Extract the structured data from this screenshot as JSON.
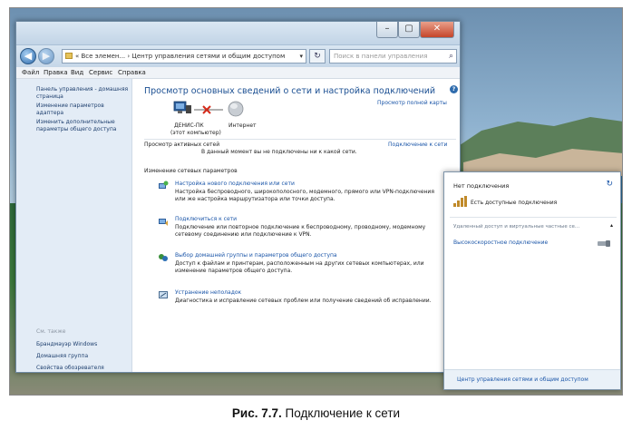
{
  "window": {
    "address": "« Все элемен... › Центр управления сетями и общим доступом",
    "search_placeholder": "Поиск в панели управления",
    "close_glyph": "✕",
    "max_glyph": "▢",
    "min_glyph": "–",
    "back_glyph": "◀",
    "forward_glyph": "▶",
    "refresh_glyph": "↻",
    "dropdown_glyph": "▾",
    "search_glyph": "⌕"
  },
  "menu": [
    "Файл",
    "Правка",
    "Вид",
    "Сервис",
    "Справка"
  ],
  "sidebar": {
    "items": [
      "Панель управления - домашняя страница",
      "Изменение параметров адаптера",
      "Изменить дополнительные параметры общего доступа"
    ],
    "see_also_title": "См. также",
    "see_also": [
      "Брандмауэр Windows",
      "Домашняя группа",
      "Свойства обозревателя"
    ]
  },
  "main": {
    "title": "Просмотр основных сведений о сети и настройка подключений",
    "view_full_map": "Просмотр полной карты",
    "computer_name": "ДЕНИС-ПК",
    "computer_sub": "(этот компьютер)",
    "internet_label": "Интернет",
    "active_networks_label": "Просмотр активных сетей",
    "no_connection_text": "В данный момент вы не подключены ни к какой сети.",
    "connect_link": "Подключение к сети",
    "change_settings_label": "Изменение сетевых параметров",
    "tasks": [
      {
        "title": "Настройка нового подключения или сети",
        "description": "Настройка беспроводного, широкополосного, модемного, прямого или VPN-подключения или же настройка маршрутизатора или точки доступа."
      },
      {
        "title": "Подключиться к сети",
        "description": "Подключение или повторное подключение к беспроводному, проводному, модемному сетевому соединению или подключение к VPN."
      },
      {
        "title": "Выбор домашней группы и параметров общего доступа",
        "description": "Доступ к файлам и принтерам, расположенным на других сетевых компьютерах, или изменение параметров общего доступа."
      },
      {
        "title": "Устранение неполадок",
        "description": "Диагностика и исправление сетевых проблем или получение сведений об исправлении."
      }
    ]
  },
  "flyout": {
    "status": "Нет подключения",
    "available": "Есть доступные подключения",
    "section": "Удаленный доступ и виртуальные частные се...",
    "connection": "Высокоскоростное подключение",
    "footer_link": "Центр управления сетями и общим доступом",
    "refresh_glyph": "↻",
    "collapse_glyph": "▴"
  },
  "caption": {
    "label": "Рис. 7.7.",
    "text": "Подключение к сети"
  },
  "colors": {
    "link": "#1a55a8",
    "title_blue": "#1b4f92",
    "sidebar_bg": "#e3ecf6",
    "error_red": "#d42a1a"
  }
}
